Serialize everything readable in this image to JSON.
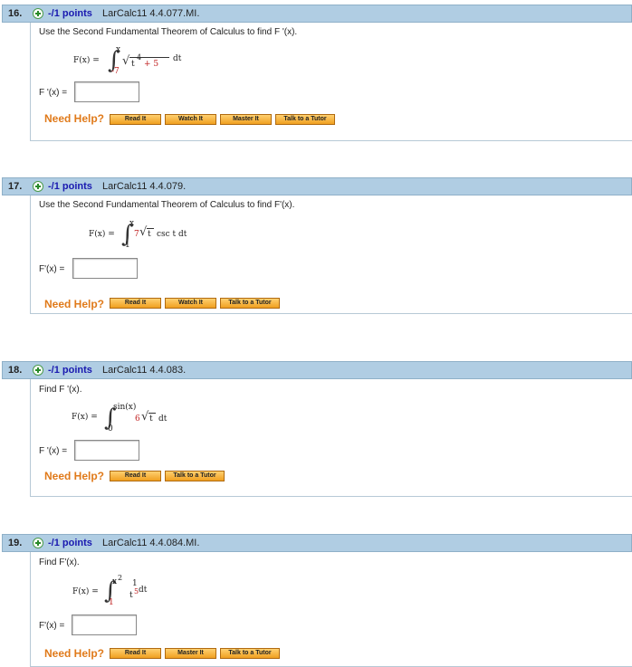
{
  "questions": [
    {
      "number": "16.",
      "points": "-/1 points",
      "reference": "LarCalc11 4.4.077.MI.",
      "prompt": "Use the Second Fundamental Theorem of Calculus to find F '(x).",
      "formula": {
        "lhs": "F(x) = ",
        "upper": "x",
        "lower": "-7",
        "body": "t",
        "exp": "4",
        "plus": "+ 5",
        "tail": "dt"
      },
      "answer_label": "F '(x) =",
      "answer_value": "",
      "need_help": "Need Help?",
      "buttons": [
        "Read It",
        "Watch It",
        "Master It",
        "Talk to a Tutor"
      ]
    },
    {
      "number": "17.",
      "points": "-/1 points",
      "reference": "LarCalc11 4.4.079.",
      "prompt": "Use the Second Fundamental Theorem of Calculus to find F'(x).",
      "formula": {
        "lhs": "F(x) = ",
        "upper": "x",
        "lower": "1",
        "coef": "7",
        "body": "t",
        "tail": "csc t dt"
      },
      "answer_label": "F'(x) =",
      "answer_value": "",
      "need_help": "Need Help?",
      "buttons": [
        "Read It",
        "Watch It",
        "Talk to a Tutor"
      ]
    },
    {
      "number": "18.",
      "points": "-/1 points",
      "reference": "LarCalc11 4.4.083.",
      "prompt": "Find F '(x).",
      "formula": {
        "lhs": "F(x) = ",
        "upper": "sin(x)",
        "lower": "0",
        "coef": "6",
        "body": "t",
        "tail": "dt"
      },
      "answer_label": "F '(x) =",
      "answer_value": "",
      "need_help": "Need Help?",
      "buttons": [
        "Read It",
        "Talk to a Tutor"
      ]
    },
    {
      "number": "19.",
      "points": "-/1 points",
      "reference": "LarCalc11 4.4.084.MI.",
      "prompt": "Find F'(x).",
      "formula": {
        "lhs": "F(x) = ",
        "upper": "x",
        "upper_exp": "2",
        "lower": "1",
        "num": "1",
        "den": "t",
        "den_exp": "5",
        "tail": "dt"
      },
      "answer_label": "F'(x) =",
      "answer_value": "",
      "need_help": "Need Help?",
      "buttons": [
        "Read It",
        "Master It",
        "Talk to a Tutor"
      ]
    }
  ],
  "colors": {
    "header_bg": "#b0cde3",
    "points_text": "#1a1ab0",
    "help_text": "#e07a1a",
    "limit_red": "#c02020"
  }
}
